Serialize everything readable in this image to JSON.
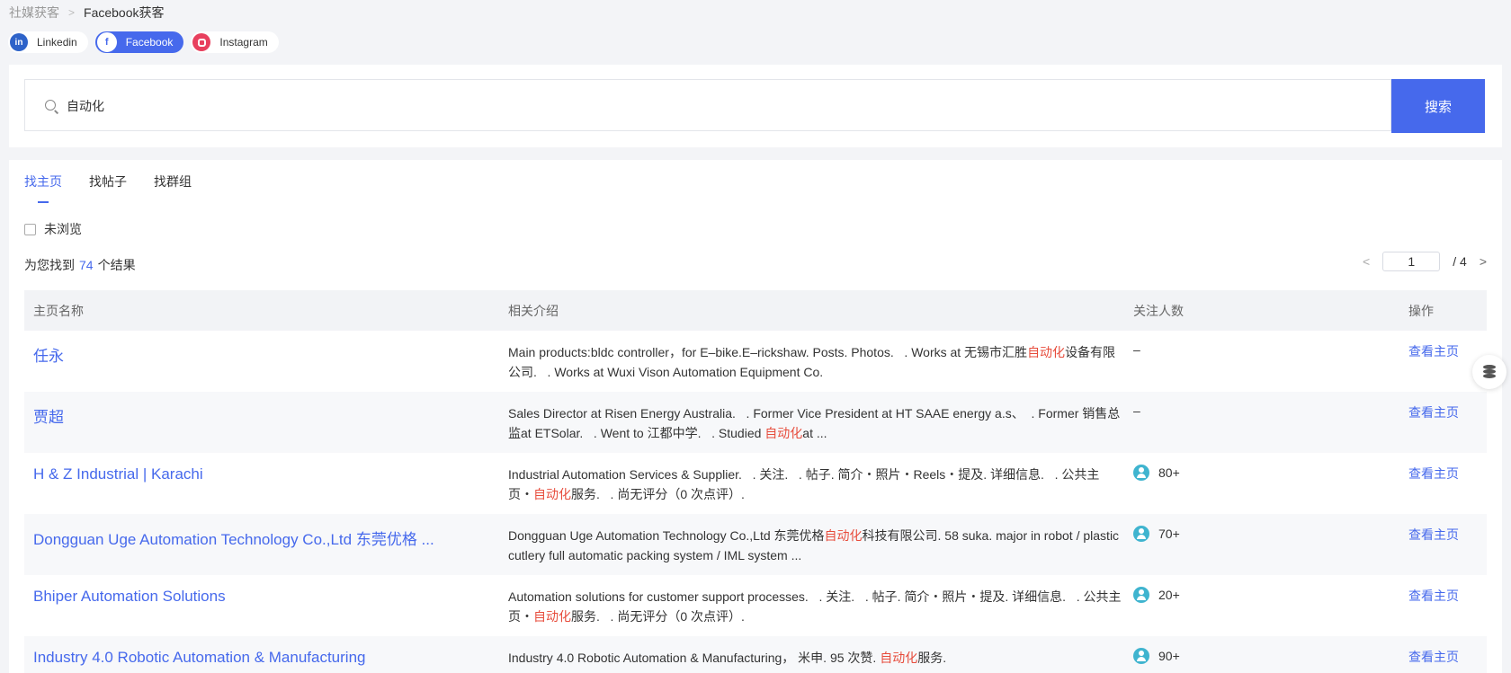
{
  "breadcrumb": {
    "parent": "社媒获客",
    "current": "Facebook获客"
  },
  "platforms": [
    {
      "label": "Linkedin",
      "icon": "linkedin-icon",
      "active": false
    },
    {
      "label": "Facebook",
      "icon": "facebook-icon",
      "active": true
    },
    {
      "label": "Instagram",
      "icon": "instagram-icon",
      "active": false
    }
  ],
  "search": {
    "value": "自动化",
    "button_label": "搜索"
  },
  "tabs": [
    {
      "label": "找主页",
      "active": true
    },
    {
      "label": "找帖子",
      "active": false
    },
    {
      "label": "找群组",
      "active": false
    }
  ],
  "filter": {
    "unviewed_label": "未浏览"
  },
  "results": {
    "prefix": "为您找到",
    "count": "74",
    "suffix": "个结果"
  },
  "pager": {
    "current": "1",
    "total": "/ 4"
  },
  "table": {
    "headers": {
      "name": "主页名称",
      "desc": "相关介绍",
      "followers": "关注人数",
      "action": "操作"
    },
    "rows": [
      {
        "name": "任永",
        "desc_before": "Main products:bldc controller，for E–bike.E–rickshaw. Posts. Photos.   . Works at 无锡市汇胜",
        "desc_hl": "自动化",
        "desc_after": "设备有限公司.   . Works at Wuxi Vison Automation Equipment Co.",
        "followers": "–",
        "has_icon": false,
        "action": "查看主页"
      },
      {
        "name": "贾超",
        "desc_before": "Sales Director at Risen Energy Australia.   . Former Vice President at HT SAAE energy a.s、  . Former 销售总监at ETSolar.   . Went to 江都中学.   . Studied ",
        "desc_hl": "自动化",
        "desc_after": "at ...",
        "followers": "–",
        "has_icon": false,
        "action": "查看主页"
      },
      {
        "name": "H & Z Industrial | Karachi",
        "desc_before": "Industrial Automation Services & Supplier.   . 关注.   . 帖子. 简介・照片・Reels・提及. 详细信息.   . 公共主页・",
        "desc_hl": "自动化",
        "desc_after": "服务.   . 尚无评分（0 次点评）.",
        "followers": "80+",
        "has_icon": true,
        "action": "查看主页"
      },
      {
        "name": "Dongguan Uge Automation Technology Co.,Ltd 东莞优格 ...",
        "desc_before": "Dongguan Uge Automation Technology Co.,Ltd 东莞优格",
        "desc_hl": "自动化",
        "desc_after": "科技有限公司. 58 suka. major in robot / plastic cutlery full automatic packing system / IML system ...",
        "followers": "70+",
        "has_icon": true,
        "action": "查看主页"
      },
      {
        "name": "Bhiper Automation Solutions",
        "desc_before": "Automation solutions for customer support processes.   . 关注.   . 帖子. 简介・照片・提及. 详细信息.   . 公共主页・",
        "desc_hl": "自动化",
        "desc_after": "服务.   . 尚无评分（0 次点评）.",
        "followers": "20+",
        "has_icon": true,
        "action": "查看主页"
      },
      {
        "name": "Industry 4.0 Robotic Automation & Manufacturing",
        "desc_before": "Industry 4.0 Robotic Automation & Manufacturing， 米申. 95 次赞. ",
        "desc_hl": "自动化",
        "desc_after": "服务.",
        "followers": "90+",
        "has_icon": true,
        "action": "查看主页"
      }
    ]
  },
  "float_button": {
    "icon": "database-icon"
  },
  "colors": {
    "accent": "#4669ec",
    "highlight": "#e74c3c",
    "follower_icon": "#3fb4cf"
  }
}
